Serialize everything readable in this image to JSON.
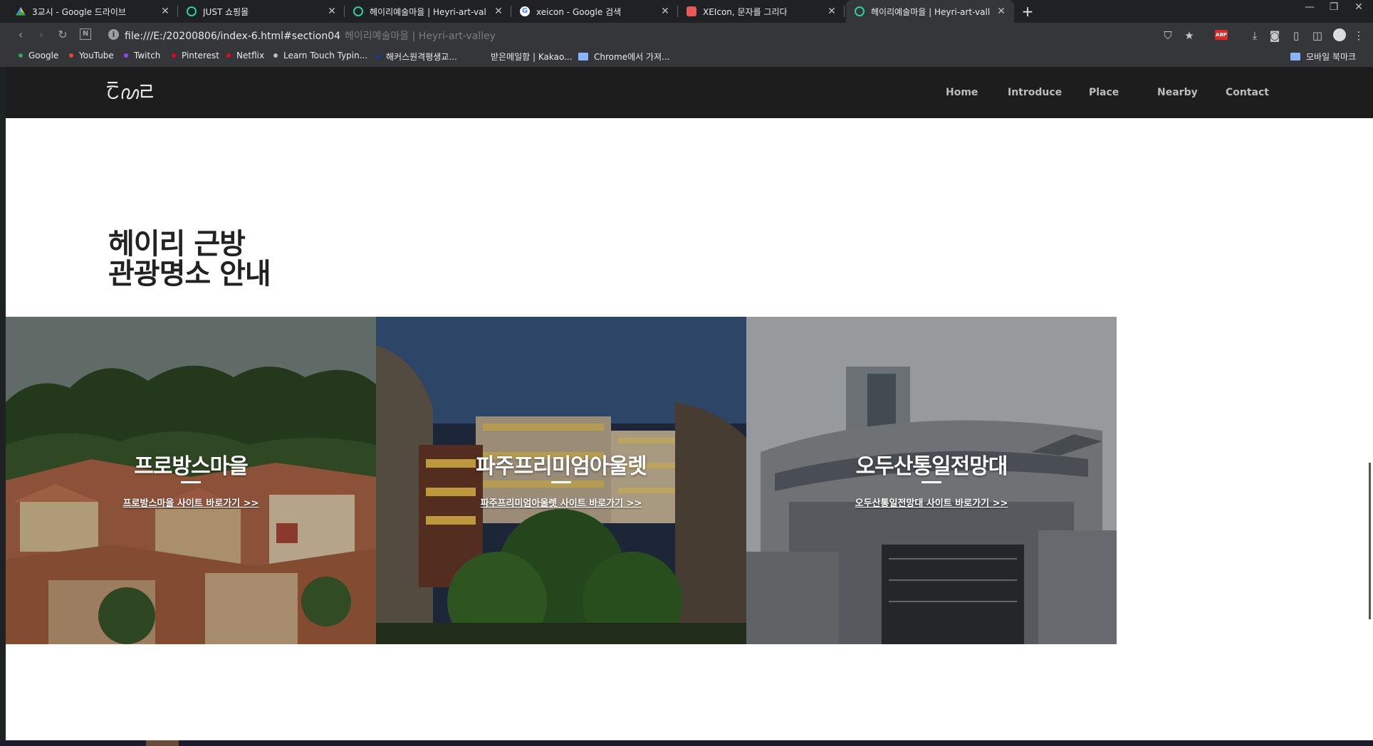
{
  "browser": {
    "tabs": [
      {
        "title": "3교시 - Google 드라이브",
        "icon": "google-drive-icon"
      },
      {
        "title": "JUST 쇼핑몰",
        "icon": "globe-icon"
      },
      {
        "title": "헤이리예술마을 | Heyri-art-valle",
        "icon": "globe-icon"
      },
      {
        "title": "xeicon - Google 검색",
        "icon": "google-icon"
      },
      {
        "title": "XEIcon, 문자를 그리다",
        "icon": "xeicon-icon"
      },
      {
        "title": "헤이리예술마을 | Heyri-art-valle",
        "icon": "globe-icon"
      }
    ],
    "address": {
      "url": "file:///E:/20200806/index-6.html#section04",
      "page_title": "헤이리예술마을 | Heyri-art-valley"
    },
    "extensions": {
      "abp": "ABP"
    },
    "bookmarks": [
      {
        "label": "Google",
        "color": "#34a853"
      },
      {
        "label": "YouTube",
        "color": "#ea4335"
      },
      {
        "label": "Twitch",
        "color": "#9146ff"
      },
      {
        "label": "Pinterest",
        "color": "#e60023"
      },
      {
        "label": "Netflix",
        "color": "#e50914"
      },
      {
        "label": "Learn Touch Typin...",
        "color": "#bdbdbd"
      },
      {
        "label": "해커스원격평생교...",
        "color": "#1a3a8a"
      },
      {
        "label": "받은메일함 | Kakao...",
        "color": "#35363a"
      },
      {
        "label": "Chrome에서 가져...",
        "color": "folder"
      }
    ],
    "mobile_bookmarks": "모바일 북마크"
  },
  "site": {
    "nav": [
      "Home",
      "Introduce",
      "Place",
      "Nearby",
      "Contact"
    ],
    "section_title": "헤이리 근방\n관광명소 안내",
    "cards": [
      {
        "name": "프로방스마을",
        "link": "프로방스마을 사이트 바로가기 >>"
      },
      {
        "name": "파주프리미엄아울렛",
        "link": "파주프리미엄아울렛 사이트 바로가기 >>"
      },
      {
        "name": "오두산통일전망대",
        "link": "오두산통일전망대 사이트 바로가기 >>"
      }
    ]
  },
  "colors": {
    "header_bg": "#1d1d1d",
    "chrome_bg": "#35363a",
    "tab_strip": "#202124"
  }
}
